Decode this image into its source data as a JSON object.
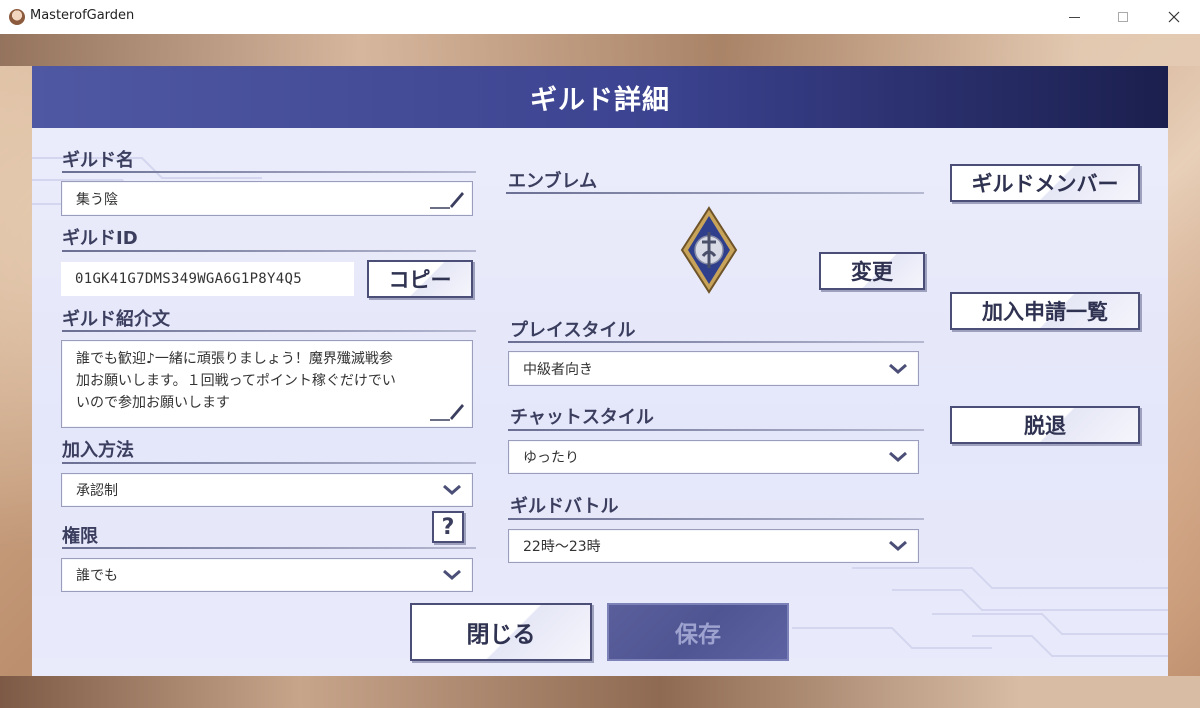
{
  "window": {
    "title": "MasterofGarden",
    "minimize_label": "—",
    "maximize_label": "☐",
    "close_label": "✕"
  },
  "dialog": {
    "title": "ギルド詳細"
  },
  "guild_name": {
    "label": "ギルド名",
    "value": "集う陰"
  },
  "guild_id": {
    "label": "ギルドID",
    "value": "01GK41G7DMS349WGA6G1P8Y4Q5",
    "copy_label": "コピー"
  },
  "intro": {
    "label": "ギルド紹介文",
    "lines": [
      "誰でも歓迎♪一緒に頑張りましょう！魔界殲滅戦参",
      "加お願いします。１回戦ってポイント稼ぐだけでい",
      "いので参加お願いします"
    ]
  },
  "join_method": {
    "label": "加入方法",
    "value": "承認制"
  },
  "permission": {
    "label": "権限",
    "value": "誰でも",
    "help_label": "?"
  },
  "emblem": {
    "label": "エンブレム",
    "change_label": "変更"
  },
  "play_style": {
    "label": "プレイスタイル",
    "value": "中級者向き"
  },
  "chat_style": {
    "label": "チャットスタイル",
    "value": "ゆったり"
  },
  "guild_battle": {
    "label": "ギルドバトル",
    "value": "22時～23時"
  },
  "side_buttons": {
    "members": "ギルドメンバー",
    "applications": "加入申請一覧",
    "leave": "脱退"
  },
  "footer": {
    "close": "閉じる",
    "save": "保存"
  },
  "colors": {
    "header_start": "#4f58a2",
    "header_end": "#1b1f4e",
    "panel_bg": "#e4e6fa",
    "button_border": "#4b4f77",
    "save_bg": "#4f5592"
  }
}
